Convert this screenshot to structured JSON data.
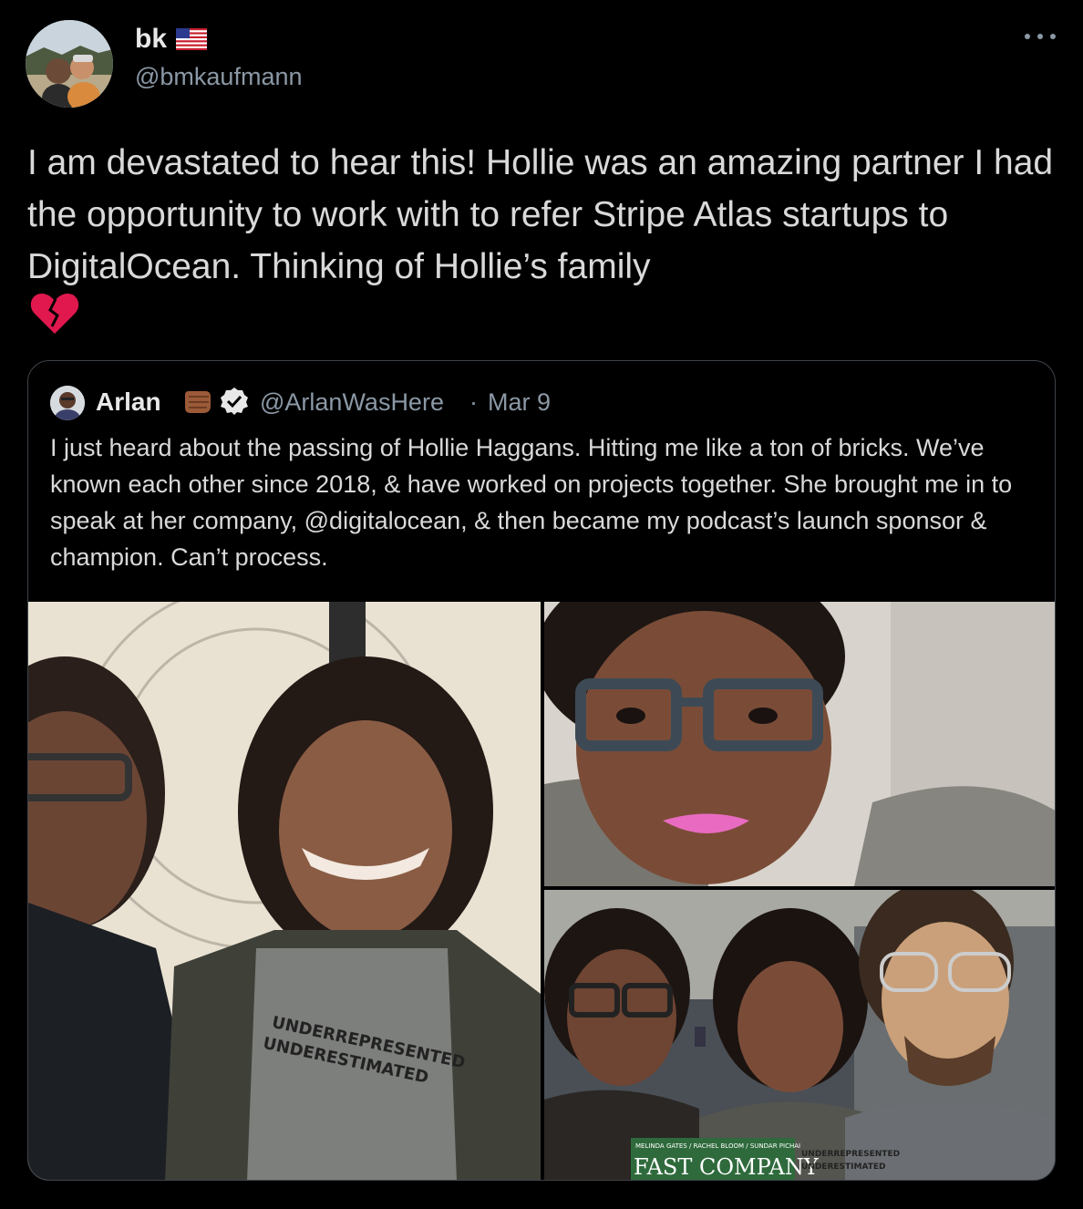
{
  "author": {
    "display_name": "bk",
    "flag": "us-flag-icon",
    "handle": "@bmkaufmann"
  },
  "tweet": {
    "text": "I am devastated to hear this! Hollie was an amazing partner I had the opportunity to work with to refer Stripe Atlas startups to DigitalOcean. Thinking of Hollie’s family",
    "emoji": "broken-heart-icon"
  },
  "quoted_tweet": {
    "display_name": "Arlan",
    "emoji": "fist-bump-icon",
    "verified": true,
    "handle": "@ArlanWasHere",
    "separator": "·",
    "date": "Mar 9",
    "text": "I just heard about the passing of Hollie Haggans. Hitting me like a ton of bricks. We’ve known each other since 2018, & have worked on projects together. She brought me in to speak at her company, @digitalocean, & then became my podcast’s launch sponsor & champion. Can’t process.",
    "photos": [
      {
        "name": "photo-two-women",
        "shirt_text_1": "UNDERREPRESENTED",
        "shirt_text_2": "UNDERESTIMATED"
      },
      {
        "name": "photo-selfie-glasses"
      },
      {
        "name": "photo-group-three",
        "magazine_title": "FAST COMPANY",
        "magazine_names": "MELINDA GATES / RACHEL BLOOM / SUNDAR PICHAI",
        "shirt_text_1": "UNDERREPRESENTED",
        "shirt_text_2": "UNDERESTIMATED"
      }
    ]
  },
  "colors": {
    "background": "#000000",
    "text": "#d9d9d9",
    "muted": "#8b98a5",
    "border": "#3d4349",
    "verified": "#e8e8e8"
  }
}
